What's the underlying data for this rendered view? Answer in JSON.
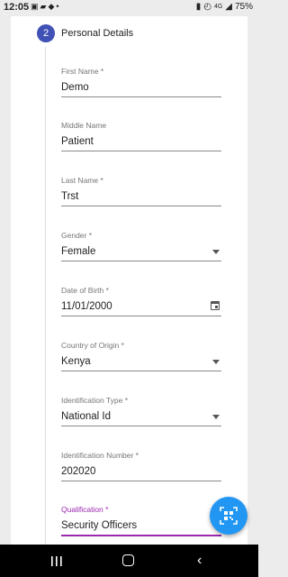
{
  "status_bar": {
    "time": "12:05",
    "battery": "75%",
    "network": "4G",
    "left_icons": [
      "image-icon",
      "message-icon",
      "twitter-icon",
      "dot-icon"
    ],
    "right_icons": [
      "battery-saver-icon",
      "alarm-icon",
      "signal-icon",
      "battery-icon"
    ]
  },
  "step": {
    "number": "2",
    "title": "Personal Details"
  },
  "fields": [
    {
      "label": "First Name *",
      "value": "Demo",
      "type": "text"
    },
    {
      "label": "Middle Name",
      "value": "Patient",
      "type": "text"
    },
    {
      "label": "Last Name *",
      "value": "Trst",
      "type": "text"
    },
    {
      "label": "Gender *",
      "value": "Female",
      "type": "select"
    },
    {
      "label": "Date of Birth *",
      "value": "11/01/2000",
      "type": "date"
    },
    {
      "label": "Country of Origin *",
      "value": "Kenya",
      "type": "select"
    },
    {
      "label": "Identification Type *",
      "value": "National Id",
      "type": "select"
    },
    {
      "label": "Identification Number *",
      "value": "202020",
      "type": "text"
    },
    {
      "label": "Qualification *",
      "value": "Security Officers",
      "type": "text",
      "focused": true
    }
  ],
  "fab": {
    "icon": "qr-scan-icon"
  },
  "colors": {
    "step_circle": "#3f51b5",
    "focus": "#9c27b0",
    "fab": "#2196f3"
  }
}
